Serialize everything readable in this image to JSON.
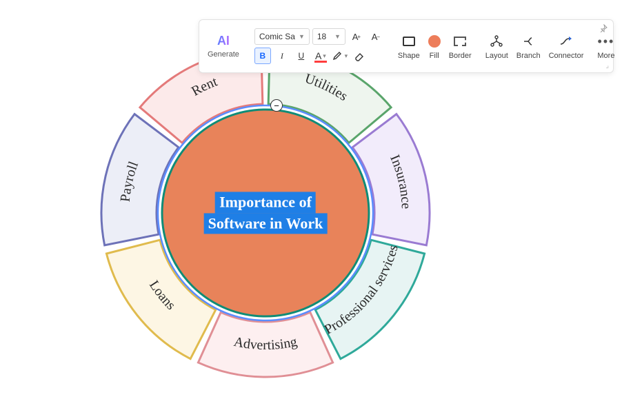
{
  "toolbar": {
    "ai": {
      "icon": "AI",
      "label": "Generate"
    },
    "font_family": "Comic Sa",
    "font_size": "18",
    "bold": "B",
    "italic": "I",
    "underline": "U",
    "tools": {
      "shape": "Shape",
      "fill": "Fill",
      "border": "Border",
      "layout": "Layout",
      "branch": "Branch",
      "connector": "Connector",
      "more": "More"
    }
  },
  "diagram": {
    "center": {
      "line1": "Importance of",
      "line2": "Software in Work"
    },
    "collapse": "−",
    "segments": [
      {
        "id": "rent",
        "label": "Rent",
        "fill": "#fceaea",
        "stroke": "#e47a7a"
      },
      {
        "id": "utilities",
        "label": "Utilities",
        "fill": "#eef5ee",
        "stroke": "#5aa56b"
      },
      {
        "id": "insurance",
        "label": "Insurance",
        "fill": "#f2ecfb",
        "stroke": "#9a7bd2"
      },
      {
        "id": "professional",
        "label": "Professional services",
        "fill": "#e7f4f3",
        "stroke": "#2fa99a"
      },
      {
        "id": "advertising",
        "label": "Advertising",
        "fill": "#fdeff0",
        "stroke": "#e08f95"
      },
      {
        "id": "loans",
        "label": "Loans",
        "fill": "#fdf6e4",
        "stroke": "#e0bb4d"
      },
      {
        "id": "payroll",
        "label": "Payroll",
        "fill": "#eceef7",
        "stroke": "#6d72b8"
      }
    ]
  }
}
